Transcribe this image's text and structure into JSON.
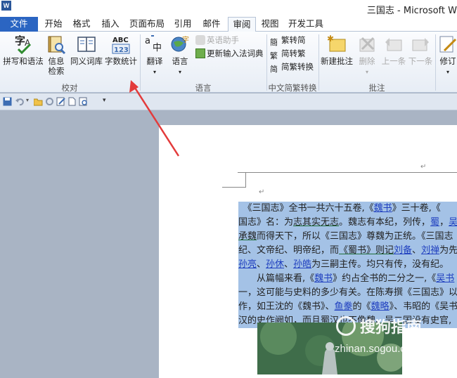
{
  "window": {
    "title": "三国志 - Microsoft W",
    "app_icon": "W"
  },
  "tabs": [
    {
      "label": "文件"
    },
    {
      "label": "开始"
    },
    {
      "label": "格式"
    },
    {
      "label": "插入"
    },
    {
      "label": "页面布局"
    },
    {
      "label": "引用"
    },
    {
      "label": "邮件"
    },
    {
      "label": "审阅"
    },
    {
      "label": "视图"
    },
    {
      "label": "开发工具"
    }
  ],
  "ribbon": {
    "proofing": {
      "label": "校对",
      "spelling": "拼写和语法",
      "research_1": "信息",
      "research_2": "检索",
      "thesaurus": "同义词库",
      "wordcount": "字数统计",
      "wordcount_icon_text_1": "ABC",
      "wordcount_icon_text_2": "123"
    },
    "language": {
      "label": "语言",
      "translate": "翻译",
      "language": "语言",
      "english_assistant": "英语助手",
      "update_ime": "更新输入法词典"
    },
    "chinese_conversion": {
      "label": "中文简繁转换",
      "to_simplified": "繁转简",
      "to_traditional": "简转繁",
      "convert": "简繁转换"
    },
    "comments": {
      "label": "批注",
      "new_comment": "新建批注",
      "delete": "删除",
      "previous": "上一条",
      "next": "下一条"
    },
    "tracking": {
      "track_changes": "修订"
    }
  },
  "document": {
    "lines": [
      [
        "　《三国志》全书一共六十五卷,《",
        {
          "t": "魏书",
          "l": true
        },
        "》三十卷,《"
      ],
      [
        "国志》名：为",
        {
          "t": "志其实无志",
          "u": true
        },
        "。魏志有本纪，列传，",
        {
          "t": "蜀",
          "l": true
        },
        "，",
        {
          "t": "吴",
          "l": true
        }
      ],
      [
        {
          "t": "承魏",
          "u": true
        },
        "而得天下，所以《三国志》尊魏为正统。《三国志"
      ],
      [
        "纪、文帝纪、明帝纪，而",
        {
          "t": "《蜀书》则记",
          "u": true
        },
        {
          "t": "刘备",
          "l": true
        },
        "、",
        {
          "t": "刘禅",
          "l": true
        },
        "为先"
      ],
      [
        {
          "t": "孙亮",
          "l": true
        },
        "、",
        {
          "t": "孙休",
          "l": true
        },
        "、",
        {
          "t": "孙皓",
          "l": true
        },
        "为三嗣主传。均只有传，没有纪。"
      ],
      [
        "　　从篇幅来看,《",
        {
          "t": "魏书",
          "l": true
        },
        "》约占全书的二分之一,《",
        {
          "t": "吴书",
          "l": true
        }
      ],
      [
        "一，这可能与史料的多少有关。在陈寿撰《三国志》以"
      ],
      [
        "作，如王沈的《魏书》、",
        {
          "t": "鱼豢",
          "l": true
        },
        "的《",
        {
          "t": "魏略",
          "l": true
        },
        "》、韦昭的《吴书"
      ],
      [
        "汉的史作阙如，而且蜀汉也不像魏、吴二国设有史官,"
      ]
    ]
  },
  "watermark": {
    "text": "搜狗指南",
    "url": "zhinan.sogou.com"
  },
  "colors": {
    "accent": "#2b65c2",
    "selection": "#a4c2e6",
    "link": "#1f3fbf",
    "arrow": "#e33b3b"
  }
}
